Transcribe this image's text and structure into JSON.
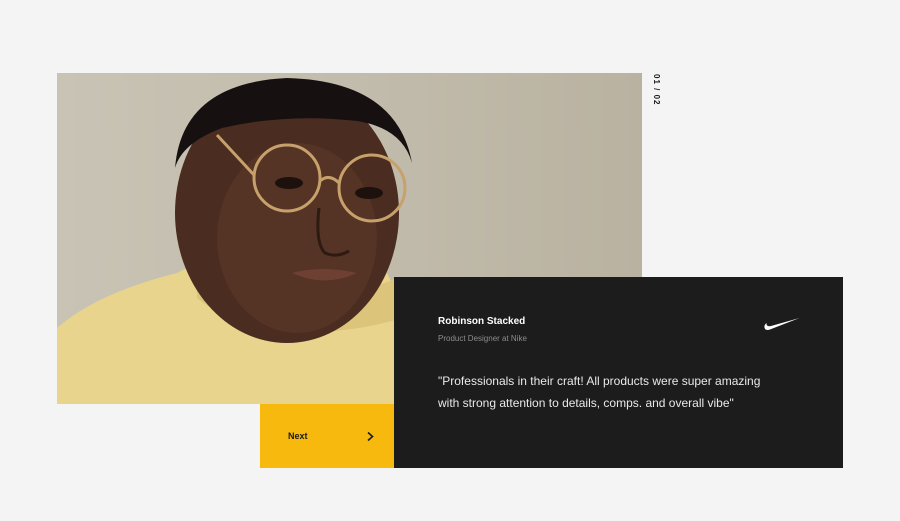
{
  "slider": {
    "counter": "01 / 02",
    "next_label": "Next"
  },
  "testimonial": {
    "name": "Robinson Stacked",
    "role": "Product Designer at Nike",
    "quote": "\"Professionals in their craft! All products were super amazing with strong attention to details, comps. and overall vibe\"",
    "brand_icon": "nike-swoosh-icon"
  },
  "colors": {
    "background": "#f4f4f4",
    "accent": "#f7b90d",
    "card": "#1c1c1c"
  }
}
